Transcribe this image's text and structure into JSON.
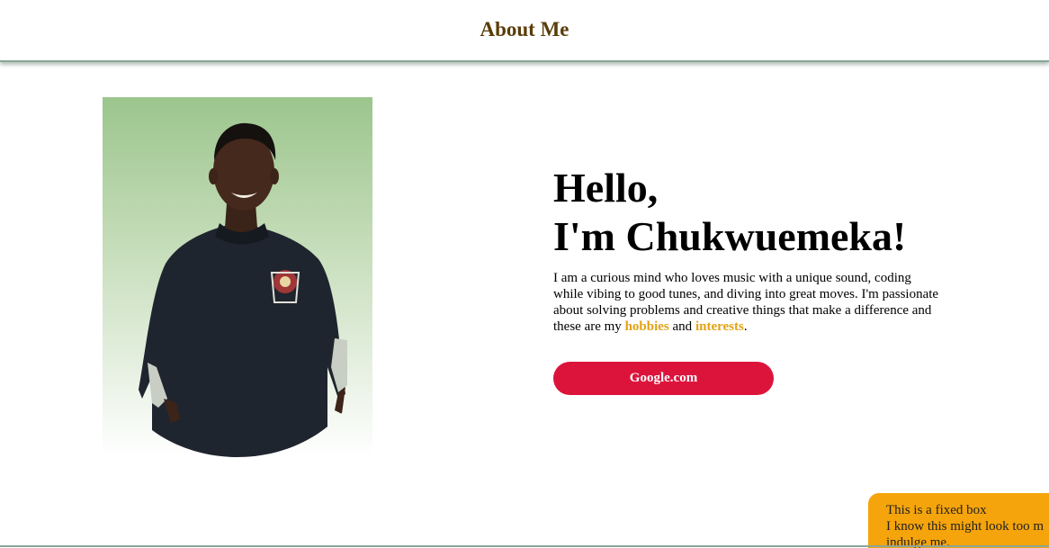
{
  "header": {
    "title": "About Me"
  },
  "hero": {
    "greeting_line1": "Hello,",
    "greeting_line2": "I'm Chukwuemeka!",
    "intro": "I am a curious mind who loves music with a unique sound, coding while vibing to good tunes, and diving into great moves. I'm passionate about solving problems and creative things that make a difference and these are my",
    "link_hobbies": "hobbies",
    "conjunction": "and",
    "link_interests": "interests",
    "period": ".",
    "button_label": "Google.com"
  },
  "fixed_box": {
    "line1": "This is a fixed box",
    "line2": "I know this might look too m",
    "line3": "indulge me."
  },
  "colors": {
    "header_title": "#5a3d0a",
    "accent_link": "#e3a215",
    "button_bg": "#dc143c",
    "fixed_box_bg": "#f5a40b",
    "divider": "#8aa598"
  }
}
